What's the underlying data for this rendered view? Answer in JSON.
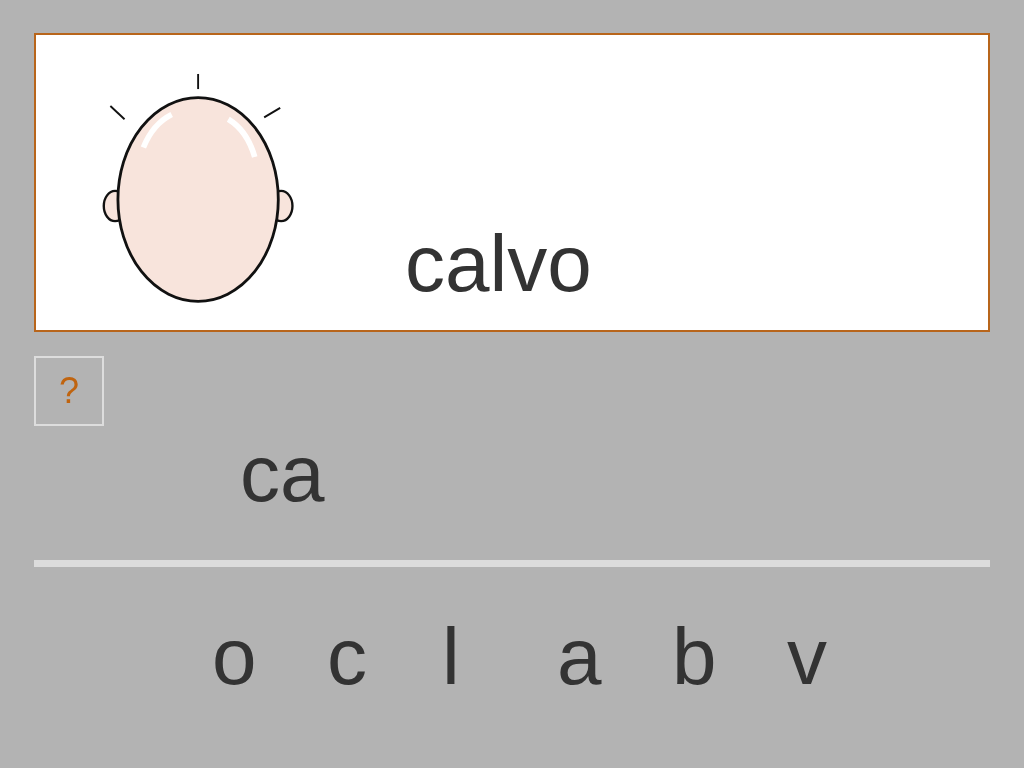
{
  "card": {
    "word": "calvo"
  },
  "help_button": {
    "label": "?"
  },
  "answer": {
    "value": "ca"
  },
  "letters": [
    "o",
    "c",
    "l",
    "a",
    "b",
    "v"
  ]
}
